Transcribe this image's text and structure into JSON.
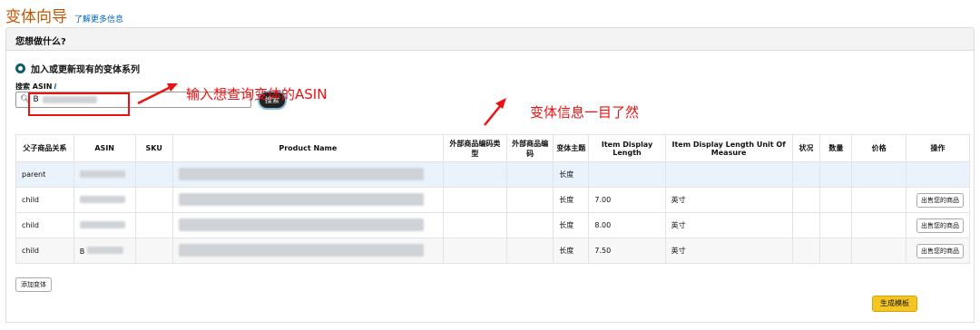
{
  "header": {
    "title": "变体向导",
    "learn_more": "了解更多信息"
  },
  "section": {
    "question": "您想做什么?"
  },
  "option": {
    "label": "加入或更新现有的变体系列"
  },
  "search": {
    "label": "搜索 ASIN",
    "info": "i",
    "value": "B",
    "button": "搜索"
  },
  "annotations": {
    "search_hint": "输入想查询变体的ASIN",
    "table_hint": "变体信息一目了然"
  },
  "table": {
    "headers": [
      "父子商品关系",
      "ASIN",
      "SKU",
      "Product Name",
      "外部商品编码类型",
      "外部商品编码",
      "变体主题",
      "Item Display Length",
      "Item Display Length Unit Of Measure",
      "状况",
      "数量",
      "价格",
      "操作"
    ],
    "rows": [
      {
        "relation": "parent",
        "asin": "",
        "theme": "长度",
        "length": "",
        "unit": "",
        "action": ""
      },
      {
        "relation": "child",
        "asin": "",
        "theme": "长度",
        "length": "7.00",
        "unit": "英寸",
        "action": "出售您的商品"
      },
      {
        "relation": "child",
        "asin": "",
        "theme": "长度",
        "length": "8.00",
        "unit": "英寸",
        "action": "出售您的商品"
      },
      {
        "relation": "child",
        "asin": "B",
        "theme": "长度",
        "length": "7.50",
        "unit": "英寸",
        "action": "出售您的商品"
      }
    ]
  },
  "buttons": {
    "add_variation": "添加变体",
    "generate_template": "生成模板"
  },
  "colors": {
    "title": "#c45500",
    "link": "#0066c0",
    "annotation": "#ee1111",
    "primary": "#f5c623"
  }
}
